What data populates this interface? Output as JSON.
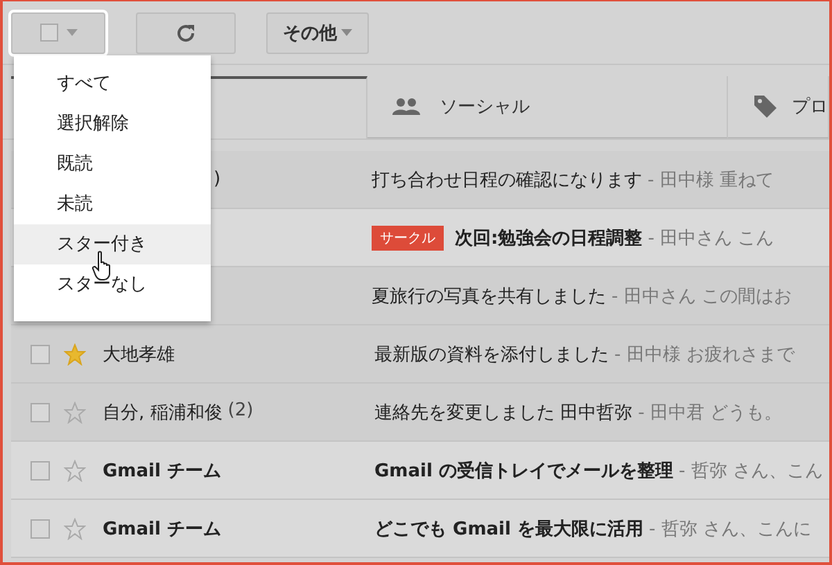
{
  "toolbar": {
    "more_button": "その他"
  },
  "select_menu": {
    "items": [
      {
        "label": "すべて",
        "selected": false
      },
      {
        "label": "選択解除",
        "selected": false
      },
      {
        "label": "既読",
        "selected": false
      },
      {
        "label": "未読",
        "selected": false
      },
      {
        "label": "スター付き",
        "selected": true
      },
      {
        "label": "スターなし",
        "selected": false
      }
    ]
  },
  "tabs": [
    {
      "selected": true
    },
    {
      "label": "ソーシャル",
      "selected": false
    },
    {
      "label": "プロ",
      "selected": false
    }
  ],
  "messages": [
    {
      "sender": ")",
      "subject": "打ち合わせ日程の確認になります",
      "snippet": "- 田中様 重ねて",
      "unread": false
    },
    {
      "label": "サークル",
      "subject": "次回:勉強会の日程調整",
      "snippet": "- 田中さん こん",
      "unread": true
    },
    {
      "subject": "夏旅行の写真を共有しました",
      "snippet": "- 田中さん この間はお",
      "unread": false
    },
    {
      "sender": "大地孝雄",
      "starred": true,
      "subject": "最新版の資料を添付しました",
      "snippet": "- 田中様 お疲れさまで",
      "unread": false
    },
    {
      "sender": "自分, 稲浦和俊",
      "count": "(2)",
      "starred": false,
      "subject": "連絡先を変更しました 田中哲弥",
      "snippet": "- 田中君 どうも。",
      "unread": false
    },
    {
      "sender": "Gmail チーム",
      "starred": false,
      "subject": "Gmail の受信トレイでメールを整理",
      "snippet": "- 哲弥 さん、こん",
      "unread": true
    },
    {
      "sender": "Gmail チーム",
      "starred": false,
      "subject": "どこでも Gmail を最大限に活用",
      "snippet": "- 哲弥 さん、こんに",
      "unread": true
    }
  ]
}
